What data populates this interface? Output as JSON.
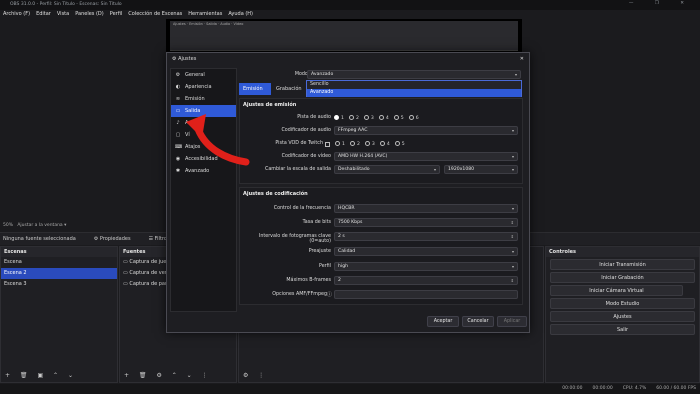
{
  "titlebar": {
    "title": "OBS 31.0.0 - Perfil: Sin Título - Escenas: Sin Título",
    "controls": "— ❐ ✕"
  },
  "menu": [
    "Archivo (F)",
    "Editar",
    "Vista",
    "Paneles (D)",
    "Perfil",
    "Colección de Escenas",
    "Herramientas",
    "Ayuda (H)"
  ],
  "preview": {
    "inner_text": "Ajustes · Emisión · Salida · Audio · Vídeo"
  },
  "below_preview": {
    "zoom": "50%",
    "fit": "Ajustar a la ventana"
  },
  "toolbar": {
    "no_source": "Ninguna fuente seleccionada",
    "properties": "⚙ Propiedades",
    "filters": "☰ Filtros"
  },
  "scenes": {
    "title": "Escenas",
    "items": [
      "Escena",
      "Escena 2",
      "Escena 3"
    ],
    "selected": 1
  },
  "sources": {
    "title": "Fuentes",
    "items": [
      "Captura de juego",
      "Captura de venta",
      "Captura de panta"
    ]
  },
  "controls": {
    "title": "Controles",
    "buttons": [
      "Iniciar Transmisión",
      "Iniciar Grabación",
      "Iniciar Cámara Virtual",
      "Modo Estudio",
      "Ajustes",
      "Salir"
    ]
  },
  "status": {
    "time1": "00:00:00",
    "time2": "00:00:00",
    "cpu": "CPU: 4.7%",
    "fps": "60.00 / 60.00 FPS"
  },
  "dialog": {
    "title": "Ajustes",
    "nav": [
      {
        "icon": "gear-icon",
        "glyph": "⚙",
        "label": "General"
      },
      {
        "icon": "palette-icon",
        "glyph": "◐",
        "label": "Apariencia"
      },
      {
        "icon": "broadcast-icon",
        "glyph": "≋",
        "label": "Emisión"
      },
      {
        "icon": "output-icon",
        "glyph": "▭",
        "label": "Salida"
      },
      {
        "icon": "audio-icon",
        "glyph": "♪",
        "label": "Au"
      },
      {
        "icon": "video-icon",
        "glyph": "▢",
        "label": "Ví"
      },
      {
        "icon": "keyboard-icon",
        "glyph": "⌨",
        "label": "Atajos"
      },
      {
        "icon": "accessibility-icon",
        "glyph": "◉",
        "label": "Accesibilidad"
      },
      {
        "icon": "wrench-icon",
        "glyph": "✱",
        "label": "Avanzado"
      }
    ],
    "selected_nav": 3,
    "output_mode_label": "Modo de salida",
    "output_mode_value": "Avanzado",
    "output_mode_options": [
      "Sencillo",
      "Avanzado"
    ],
    "tabs": [
      "Emisión",
      "Grabación"
    ],
    "stream_section": "Ajustes de emisión",
    "audio_track_label": "Pista de audio",
    "audio_tracks": [
      "1",
      "2",
      "3",
      "4",
      "5",
      "6"
    ],
    "audio_encoder_label": "Codificador de audio",
    "audio_encoder_value": "FFmpeg AAC",
    "twitch_vod_label": "Pista VOD de Twitch",
    "twitch_tracks": [
      "1",
      "2",
      "3",
      "4",
      "5"
    ],
    "video_encoder_label": "Codificador de vídeo",
    "video_encoder_value": "AMD HW H.264 (AVC)",
    "rescale_label": "Cambiar la escala de salida",
    "rescale_value": "Deshabilitado",
    "rescale_res": "1920x1080",
    "encoder_section": "Ajustes de codificación",
    "rate_control_label": "Control de la frecuencia",
    "rate_control_value": "HQCBR",
    "bitrate_label": "Tasa de bits",
    "bitrate_value": "7500 Kbps",
    "keyframe_label": "Intervalo de fotogramas clave (0=auto)",
    "keyframe_value": "2 s",
    "preset_label": "Preajuste",
    "preset_value": "Calidad",
    "profile_label": "Perfil",
    "profile_value": "high",
    "bframes_label": "Máximos B-frames",
    "bframes_value": "2",
    "amf_label": "Opciones AMF/FFmpeg",
    "amf_value": "",
    "accept": "Aceptar",
    "cancel": "Cancelar",
    "apply": "Aplicar"
  },
  "colors": {
    "accent": "#2f5ad8",
    "arrow": "#e0201a"
  }
}
